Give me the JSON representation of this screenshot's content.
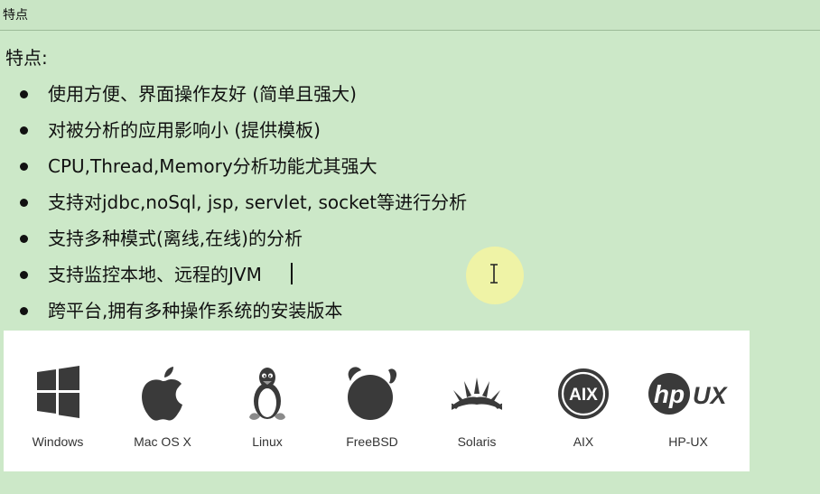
{
  "window": {
    "title": "特点"
  },
  "content": {
    "heading": "特点:",
    "features": [
      "使用方便、界面操作友好  (简单且强大)",
      "对被分析的应用影响小   (提供模板)",
      "CPU,Thread,Memory分析功能尤其强大",
      "支持对jdbc,noSql, jsp, servlet, socket等进行分析",
      "支持多种模式(离线,在线)的分析",
      "支持监控本地、远程的JVM",
      "跨平台,拥有多种操作系统的安装版本"
    ]
  },
  "platforms": [
    {
      "label": "Windows",
      "icon": "windows-logo-icon"
    },
    {
      "label": "Mac OS X",
      "icon": "apple-logo-icon"
    },
    {
      "label": "Linux",
      "icon": "tux-penguin-icon"
    },
    {
      "label": "FreeBSD",
      "icon": "freebsd-logo-icon"
    },
    {
      "label": "Solaris",
      "icon": "solaris-logo-icon"
    },
    {
      "label": "AIX",
      "icon": "aix-logo-icon"
    },
    {
      "label": "HP-UX",
      "icon": "hp-ux-logo-icon"
    }
  ],
  "colors": {
    "background": "#cce8c8",
    "panel": "#ffffff",
    "icon": "#3a3a3a",
    "cursor_highlight": "#f5f5a0"
  }
}
